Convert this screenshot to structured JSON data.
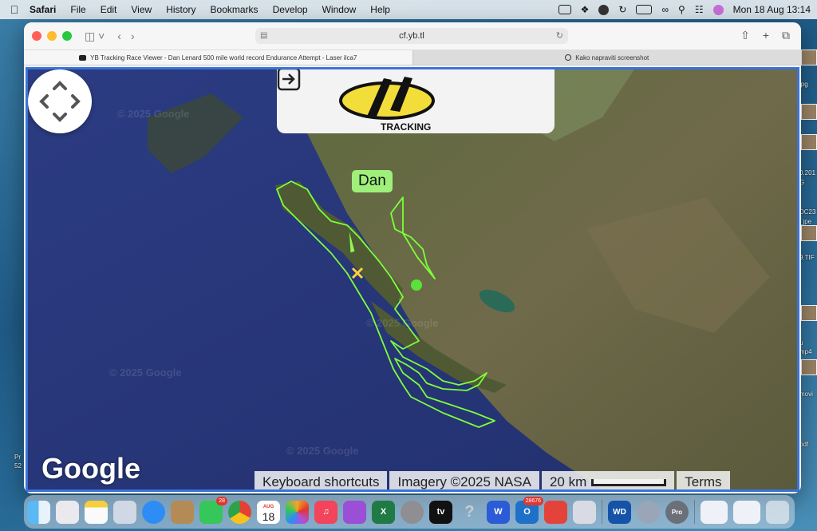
{
  "menubar": {
    "app_name": "Safari",
    "items": [
      "File",
      "Edit",
      "View",
      "History",
      "Bookmarks",
      "Develop",
      "Window",
      "Help"
    ],
    "clock": "Mon 18 Aug  13:14"
  },
  "browser": {
    "url": "cf.yb.tl",
    "tabs": [
      {
        "title": "YB Tracking Race Viewer - Dan Lenard 500 mile world record Endurance Attempt - Laser ilca7"
      },
      {
        "title": "Kako napraviti screenshot"
      }
    ]
  },
  "map": {
    "watermarks": [
      "© 2025 Google",
      "© 2025 Google",
      "© 2025 Google",
      "© 2025 Google",
      "oogle"
    ],
    "logo_text": "TRACKING",
    "boat_label": "Dan",
    "google_logo": "Google",
    "attribution": {
      "shortcuts": "Keyboard shortcuts",
      "imagery": "Imagery ©2025 NASA",
      "scale": "20 km",
      "terms": "Terms"
    },
    "track_color": "#7dff3a"
  },
  "desktop": {
    "right_labels": [
      "jpg",
      "0.201",
      "G",
      "DC23",
      "_jpe",
      "9.TIF",
      "u",
      "mp4",
      "movi",
      "pdf"
    ],
    "left_labels": [
      "Pr",
      "52"
    ]
  },
  "dock": {
    "calendar_month": "AUG",
    "calendar_day": "18",
    "messages_badge": "28",
    "outlook_badge": "28676",
    "apps": [
      "Finder",
      "Launchpad",
      "Notes",
      "Preview",
      "Safari",
      "Contacts",
      "Messages",
      "Chrome",
      "Calendar",
      "Photos",
      "Music",
      "Podcasts",
      "Excel",
      "System Settings",
      "TV",
      "Help",
      "Word",
      "Outlook",
      "AnyDesk",
      "iPhone Mirroring",
      "WD",
      "QuickTime",
      "Pro",
      "Downloads",
      "Documents",
      "Trash"
    ]
  }
}
